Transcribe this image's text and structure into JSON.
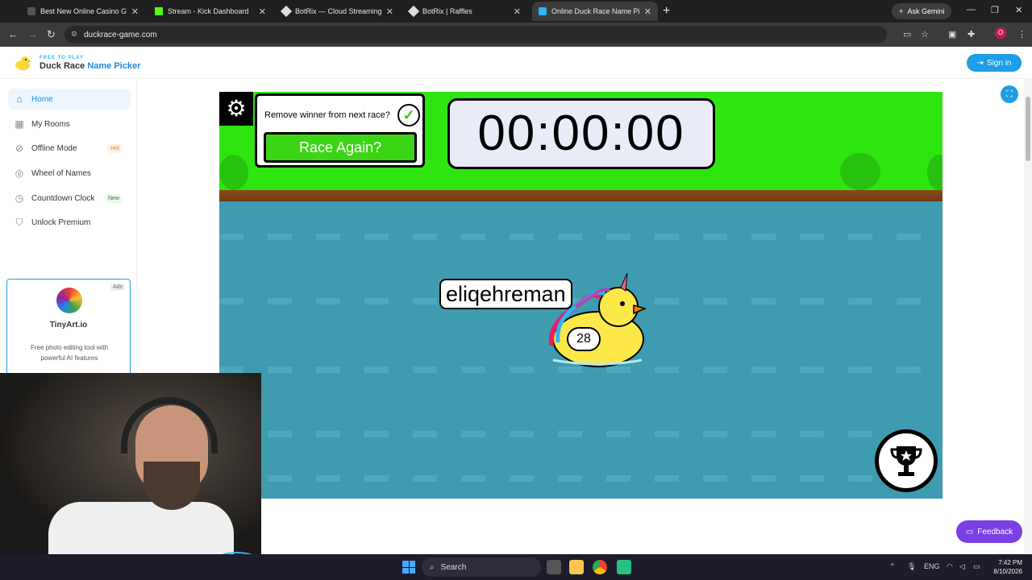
{
  "browser": {
    "tabs": [
      {
        "title": "Best New Online Casino Ga",
        "active": false
      },
      {
        "title": "Stream - Kick Dashboard",
        "active": false
      },
      {
        "title": "BotRix — Cloud Streaming Bot",
        "active": false
      },
      {
        "title": "BotRix | Raffles",
        "active": false
      },
      {
        "title": "Online Duck Race Name Pi",
        "active": true
      }
    ],
    "gemini_label": "Ask Gemini",
    "url": "duckrace-game.com",
    "profile_initial": "O"
  },
  "site": {
    "tagline": "FREE TO PLAY",
    "brand_main": "Duck Race",
    "brand_accent": "Name Picker",
    "sign_in": "Sign in",
    "accent_color": "#1e9de8"
  },
  "sidebar": {
    "items": [
      {
        "label": "Home",
        "icon": "home-icon",
        "active": true
      },
      {
        "label": "My Rooms",
        "icon": "grid-icon"
      },
      {
        "label": "Offline Mode",
        "icon": "wifi-off-icon",
        "badge": "Hot"
      },
      {
        "label": "Wheel of Names",
        "icon": "wheel-icon"
      },
      {
        "label": "Countdown Clock",
        "icon": "clock-icon",
        "badge": "New"
      },
      {
        "label": "Unlock Premium",
        "icon": "shield-icon"
      }
    ]
  },
  "ad": {
    "tag": "Ads",
    "name": "TinyArt.io",
    "description": "Free photo editing tool with powerful AI features"
  },
  "game": {
    "remove_winner_label": "Remove winner from next race?",
    "remove_winner_checked": true,
    "race_again": "Race Again?",
    "timer": "00:00:00",
    "duck_name": "eliqehreman",
    "duck_number": "28"
  },
  "feedback": "Feedback",
  "taskbar": {
    "search": "Search",
    "language": "ENG",
    "time": "7:42 PM",
    "date": "8/10/2026"
  }
}
